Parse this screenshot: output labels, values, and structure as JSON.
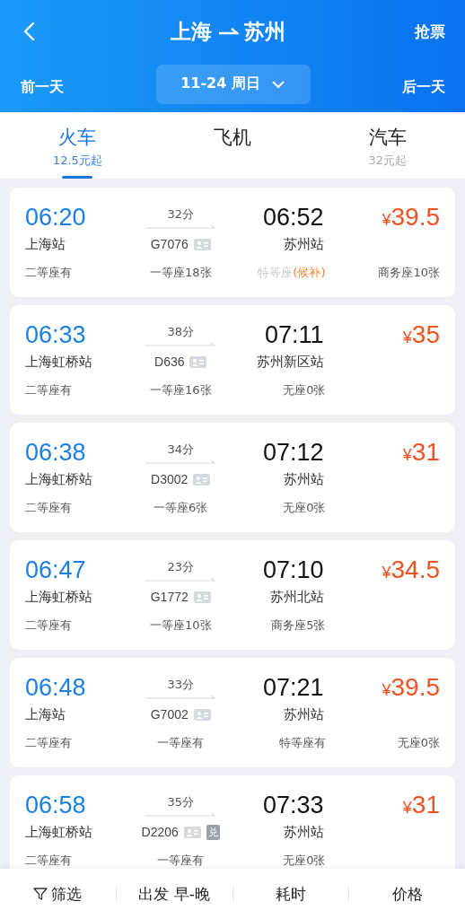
{
  "header": {
    "from": "上海",
    "to": "苏州",
    "action": "抢票",
    "prev_day": "前一天",
    "date": "11-24 周日",
    "next_day": "后一天"
  },
  "tabs": [
    {
      "label": "火车",
      "sub": "12.5元起",
      "selected": true
    },
    {
      "label": "飞机",
      "selected": false
    },
    {
      "label": "汽车",
      "sub": "32元起",
      "selected": false
    }
  ],
  "trains": [
    {
      "depart": "06:20",
      "from": "上海站",
      "duration": "32分",
      "number": "G7076",
      "arrive": "06:52",
      "to": "苏州站",
      "currency": "¥",
      "price": "39.5",
      "seats": [
        {
          "text": "二等座有",
          "available": true
        },
        {
          "text": "一等座18张",
          "available": true
        },
        {
          "text": "特等座",
          "note": "(候补)",
          "available": false
        },
        {
          "text": "商务座10张",
          "available": true
        }
      ]
    },
    {
      "depart": "06:33",
      "from": "上海虹桥站",
      "duration": "38分",
      "number": "D636",
      "arrive": "07:11",
      "to": "苏州新区站",
      "currency": "¥",
      "price": "35",
      "seats": [
        {
          "text": "二等座有",
          "available": true
        },
        {
          "text": "一等座16张",
          "available": true
        },
        {
          "text": "无座0张",
          "available": true
        }
      ]
    },
    {
      "depart": "06:38",
      "from": "上海虹桥站",
      "duration": "34分",
      "number": "D3002",
      "arrive": "07:12",
      "to": "苏州站",
      "currency": "¥",
      "price": "31",
      "seats": [
        {
          "text": "二等座有",
          "available": true
        },
        {
          "text": "一等座6张",
          "available": true
        },
        {
          "text": "无座0张",
          "available": true
        }
      ]
    },
    {
      "depart": "06:47",
      "from": "上海虹桥站",
      "duration": "23分",
      "number": "G1772",
      "arrive": "07:10",
      "to": "苏州北站",
      "currency": "¥",
      "price": "34.5",
      "seats": [
        {
          "text": "二等座有",
          "available": true
        },
        {
          "text": "一等座10张",
          "available": true
        },
        {
          "text": "商务座5张",
          "available": true
        }
      ]
    },
    {
      "depart": "06:48",
      "from": "上海站",
      "duration": "33分",
      "number": "G7002",
      "arrive": "07:21",
      "to": "苏州站",
      "currency": "¥",
      "price": "39.5",
      "seats": [
        {
          "text": "二等座有",
          "available": true
        },
        {
          "text": "一等座有",
          "available": true
        },
        {
          "text": "特等座有",
          "available": true
        },
        {
          "text": "无座0张",
          "available": true
        }
      ]
    },
    {
      "depart": "06:58",
      "from": "上海虹桥站",
      "duration": "35分",
      "number": "D2206",
      "tag": "兑",
      "arrive": "07:33",
      "to": "苏州站",
      "currency": "¥",
      "price": "31",
      "seats": [
        {
          "text": "二等座有",
          "available": true
        },
        {
          "text": "一等座有",
          "available": true
        },
        {
          "text": "无座0张",
          "available": true
        }
      ]
    }
  ],
  "sort_bar": [
    {
      "label": "筛选",
      "kind": "filter"
    },
    {
      "label": "出发 早-晚",
      "kind": "sort"
    },
    {
      "label": "耗时",
      "kind": "sort"
    },
    {
      "label": "价格",
      "kind": "sort"
    }
  ]
}
